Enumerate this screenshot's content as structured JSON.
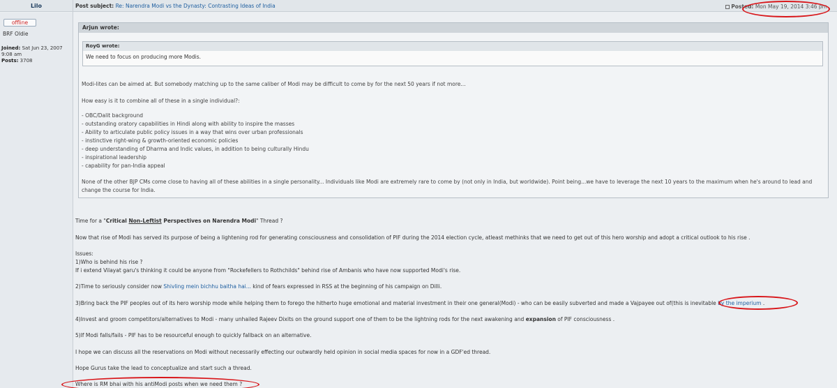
{
  "header": {
    "author": "Lilo",
    "subject_label": "Post subject:",
    "subject_value": "Re: Narendra Modi vs the Dynasty: Contrasting Ideas of India",
    "posted_label": "Posted:",
    "posted_value": "Mon May 19, 2014 3:46 pm"
  },
  "profile": {
    "status_button": "offline",
    "rank": "BRF Oldie",
    "joined_label": "Joined:",
    "joined_value": "Sat Jun 23, 2007",
    "joined_time": "9:08 am",
    "posts_label": "Posts:",
    "posts_value": "3708"
  },
  "outer_quote": {
    "header": "Arjun wrote:",
    "inner_quote": {
      "header": "RoyG wrote:",
      "text": "We need to focus on producing more Modis."
    },
    "para1": "Modi-lites can be aimed at. But somebody matching up to the same caliber of Modi may be difficult to come by for the next 50 years if not more...",
    "para2": "How easy is it to combine all of these in a single individual?:",
    "list": [
      "- OBC/Dalit background",
      "- outstanding oratory capabilities in Hindi along with ability to inspire the masses",
      "- Ability to articulate public policy issues in a way that wins over urban professionals",
      "- instinctive right-wing & growth-oriented economic policies",
      "- deep understanding of Dharma and Indic values, in addition to being culturally Hindu",
      "- inspirational leadership",
      "- capability for pan-India appeal"
    ],
    "para3_line1": "None of the other BJP CMs come close to having all of these abilities in a single personality... Individuals like Modi are extremely rare to come by (not only in India, but worldwide). Point being...we have to leverage the next 10 years to the maximum when he's around to lead and",
    "para3_line2": "change the course for India."
  },
  "post": {
    "title_prefix": "Time for a \"",
    "title_critical": "Critical ",
    "title_nonleftist": "Non-Leftist",
    "title_rest": " Perspectives on Narendra Modi",
    "title_suffix": "\" Thread ?",
    "para1": "Now that rise of Modi has served its purpose of being a lightening rod for generating consciousness and consolidation of PIF during the 2014 election cycle, atleast methinks that we need to get out of this hero worship and adopt a critical outlook to his rise .",
    "issues_label": "Issues:",
    "issue1_q": "1)Who is behind his rise ?",
    "issue1_text": "If i extend Vilayat garu's thinking it could be anyone from \"Rockefellers to Rothchilds\" behind rise of Ambanis who have now supported Modi's rise.",
    "issue2_prefix": "2)Time to seriously consider now ",
    "issue2_link": "Shivling mein bichhu baitha hai...",
    "issue2_suffix": " kind of fears expressed in RSS at the beginning of his campaign on Dilli.",
    "issue3_text": "3)Bring back the PIF peoples out of its hero worship mode while helping them to forego the hitherto huge emotional and material investment in their one general(Modi) - who can be easily subverted and made a Vajpayee out of(this is inevitable",
    "issue3_link": " by the imperium",
    "issue3_end": " .",
    "issue4_prefix": "4)Invest and groom competitors/alternatives to Modi - many unhailed Rajeev Dixits on the ground support one of them to be the lightning rods for the next awakening and ",
    "issue4_bold": "expansion",
    "issue4_suffix": " of PIF consciousness .",
    "issue5": "5)If Modi falls/fails - PIF has to be resourceful enough to quickly fallback on an alternative.",
    "hope1": "I hope we can discuss all the reservations on Modi without necessarily effecting our outwardly held opinion in social media spaces for now in a GDF'ed thread.",
    "hope2": "Hope Gurus take the lead to conceptualize and start such a thread.",
    "last": "Where is RM bhai with his antiModi posts when we need them ?"
  },
  "colors": {
    "annotation_red": "#d8161a",
    "link_blue": "#1f5fa0"
  }
}
